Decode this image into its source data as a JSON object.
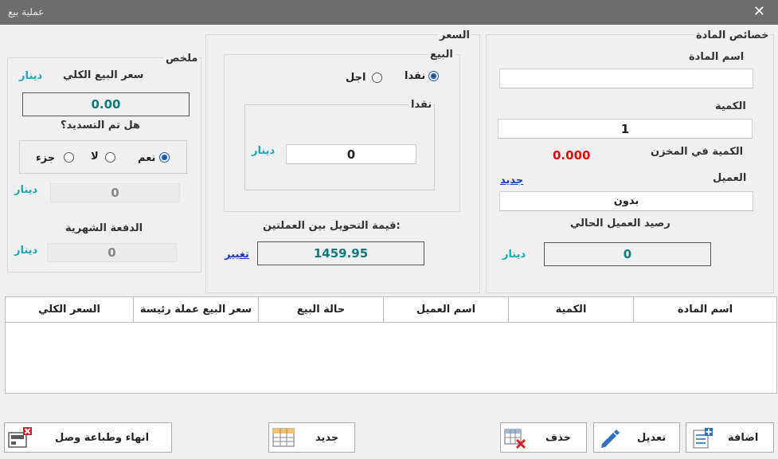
{
  "window": {
    "title": "عملية بيع",
    "close": "✕"
  },
  "properties": {
    "group_title": "خصائص المادة",
    "item_name_label": "اسم المادة",
    "item_name_value": "",
    "quantity_label": "الكمية",
    "quantity_value": "1",
    "stock_label": "الكمية في المخزن",
    "stock_value": "0.000",
    "customer_label": "العميل",
    "customer_new_link": "جديد",
    "customer_value": "بدون",
    "balance_label": "رصيد العميل الحالي",
    "balance_value": "0",
    "balance_unit": "دينار"
  },
  "price": {
    "group_title": "السعر",
    "sale_title": "البيع",
    "cash_option": "نقدا",
    "deferred_option": "اجل",
    "cash_box_title": "نقدا",
    "cash_value": "0",
    "cash_unit": "دينار",
    "conversion_label": "قيمة التحويل بين العملتين:",
    "conversion_value": "1459.95",
    "change_link": "تغيير"
  },
  "summary": {
    "group_title": "ملخص",
    "total_label": "سعر البيع الكلي",
    "total_unit": "دينار",
    "total_value": "0.00",
    "paid_question": "هل تم التسديد؟",
    "opt_yes": "نعم",
    "opt_no": "لا",
    "opt_part": "جزء",
    "paid_value": "0",
    "paid_unit": "دينار",
    "monthly_label": "الدفعة الشهرية",
    "monthly_value": "0",
    "monthly_unit": "دينار"
  },
  "table": {
    "columns": [
      "اسم المادة",
      "الكمية",
      "اسم العميل",
      "حالة البيع",
      "سعر البيع عملة رئيسة",
      "السعر الكلي"
    ]
  },
  "buttons": {
    "add": "اضافة",
    "edit": "تعديل",
    "delete": "حذف",
    "new": "جديد",
    "finish": "انهاء وطباعة وصل"
  }
}
